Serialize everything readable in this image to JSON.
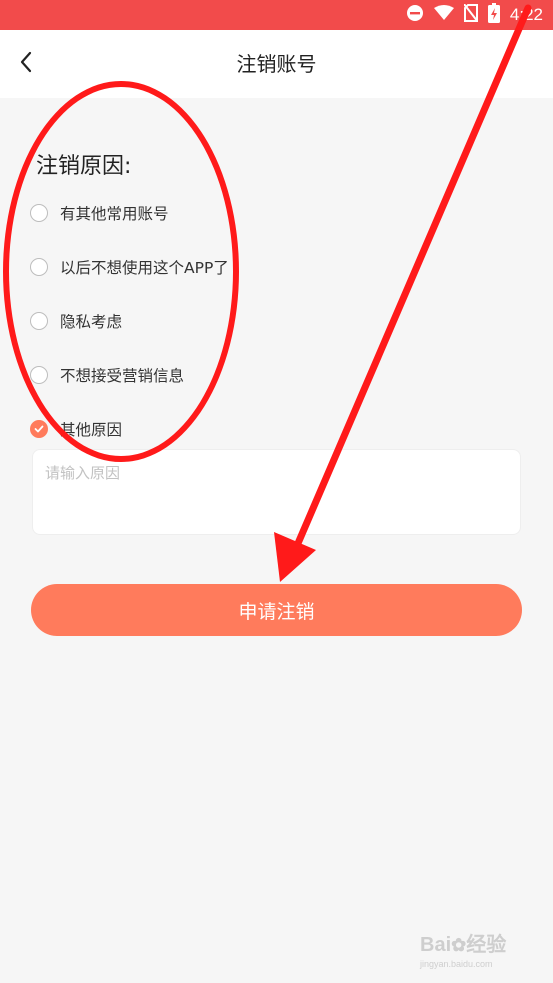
{
  "status_bar": {
    "time": "4:22",
    "icons": [
      "do-not-disturb-icon",
      "wifi-icon",
      "no-sim-icon",
      "battery-charging-icon"
    ]
  },
  "header": {
    "back_icon": "chevron-left-icon",
    "title": "注销账号"
  },
  "form": {
    "section_title": "注销原因:",
    "reasons": [
      {
        "label": "有其他常用账号",
        "checked": false
      },
      {
        "label": "以后不想使用这个APP了",
        "checked": false
      },
      {
        "label": "隐私考虑",
        "checked": false
      },
      {
        "label": "不想接受营销信息",
        "checked": false
      },
      {
        "label": "其他原因",
        "checked": true
      }
    ],
    "reason_input": {
      "value": "",
      "placeholder": "请输入原因"
    },
    "submit_label": "申请注销"
  },
  "watermark": {
    "text": "Bai",
    "text2": "经验",
    "url": "jingyan.baidu.com"
  },
  "colors": {
    "status_bar": "#f24b4b",
    "accent": "#ff7b5c",
    "annotation": "#ff1a1a",
    "background": "#f6f6f6"
  }
}
